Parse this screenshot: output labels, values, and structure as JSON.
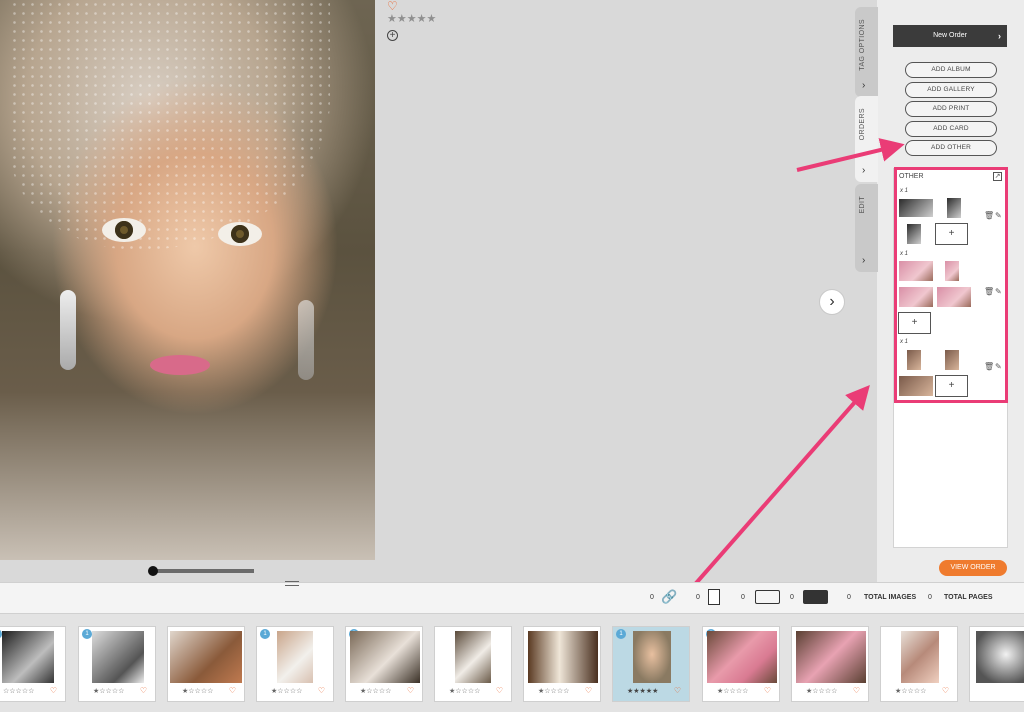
{
  "viewer": {
    "heart_glyph": "♡",
    "stars_glyph": "★★★★★",
    "add_glyph": "+",
    "next_glyph": "›"
  },
  "side_tabs": [
    {
      "label": "TAG OPTIONS",
      "chevron": "›"
    },
    {
      "label": "ORDERS",
      "chevron": "›"
    },
    {
      "label": "EDIT",
      "chevron": "›"
    }
  ],
  "orders": {
    "new_order_label": "New Order",
    "new_order_chevron": "›",
    "add_buttons": [
      "ADD ALBUM",
      "ADD GALLERY",
      "ADD PRINT",
      "ADD CARD",
      "ADD OTHER"
    ],
    "section_heading": "OTHER",
    "items": [
      {
        "qty": "x 1"
      },
      {
        "qty": "x 1"
      },
      {
        "qty": "x 1"
      }
    ],
    "add_photo_glyph": "+",
    "view_order_label": "VIEW ORDER"
  },
  "toolbar": {
    "count_a": "0",
    "count_b": "0",
    "count_c": "0",
    "count_d": "0",
    "count_images": "0",
    "total_images_label": "TOTAL IMAGES",
    "count_pages": "0",
    "total_pages_label": "TOTAL PAGES"
  },
  "filmstrip": {
    "items": [
      {
        "badge": "1",
        "stars": "☆☆☆☆☆",
        "heart": "♡"
      },
      {
        "badge": "1",
        "stars": "★☆☆☆☆",
        "heart": "♡"
      },
      {
        "badge": "",
        "stars": "★☆☆☆☆",
        "heart": "♡"
      },
      {
        "badge": "1",
        "stars": "★☆☆☆☆",
        "heart": "♡"
      },
      {
        "badge": "1",
        "stars": "★☆☆☆☆",
        "heart": "♡"
      },
      {
        "badge": "",
        "stars": "★☆☆☆☆",
        "heart": "♡"
      },
      {
        "badge": "",
        "stars": "★☆☆☆☆",
        "heart": "♡"
      },
      {
        "badge": "1",
        "stars": "★★★★★",
        "heart": "♡"
      },
      {
        "badge": "1",
        "stars": "★☆☆☆☆",
        "heart": "♡"
      },
      {
        "badge": "",
        "stars": "★☆☆☆☆",
        "heart": "♡"
      },
      {
        "badge": "",
        "stars": "★☆☆☆☆",
        "heart": "♡"
      },
      {
        "badge": "",
        "stars": "",
        "heart": ""
      }
    ]
  },
  "colors": {
    "accent_orange": "#ef7b2e",
    "highlight_pink": "#ea3c76",
    "badge_blue": "#5aa9d6"
  }
}
